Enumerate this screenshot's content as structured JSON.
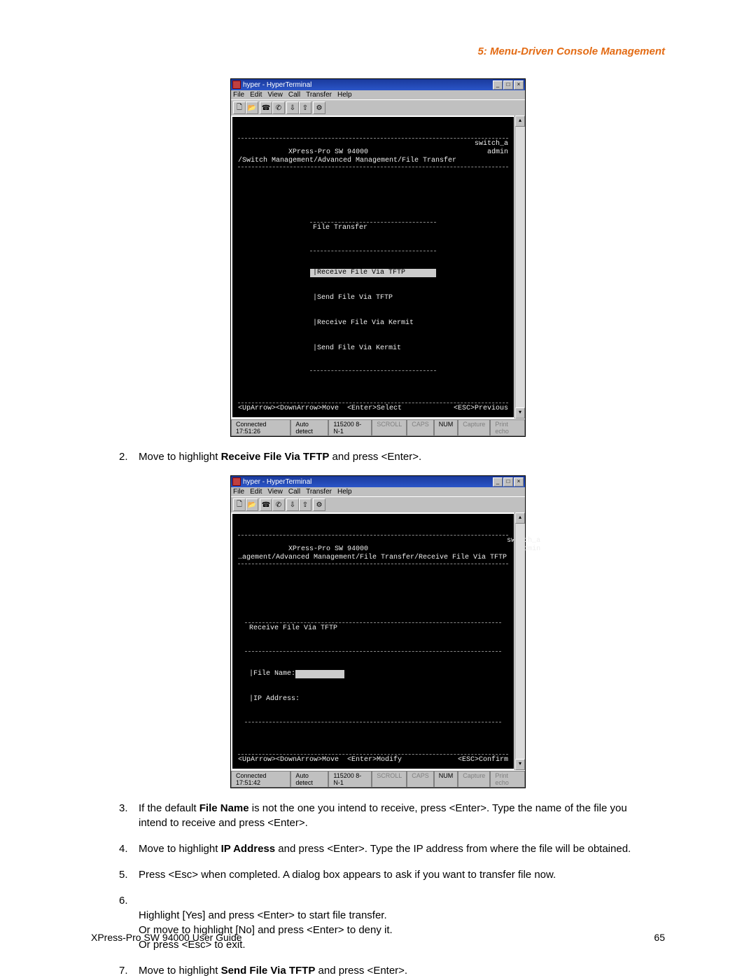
{
  "header": {
    "section_title": "5: Menu-Driven Console Management"
  },
  "screenshot_a": {
    "window_title": "hyper - HyperTerminal",
    "menus": [
      "File",
      "Edit",
      "View",
      "Call",
      "Transfer",
      "Help"
    ],
    "terminal": {
      "product": "XPress-Pro SW 94000",
      "breadcrumb": "/Switch Management/Advanced Management/File Transfer",
      "device": "switch_a",
      "user": "admin",
      "menu_title": "File Transfer",
      "items": [
        "Receive File Via TFTP",
        "Send File Via TFTP",
        "Receive File Via Kermit",
        "Send File Via Kermit"
      ],
      "footer_left": "<UpArrow><DownArrow>Move  <Enter>Select",
      "footer_right": "<ESC>Previous"
    },
    "statusbar": {
      "connected": "Connected 17:51:26",
      "detect": "Auto detect",
      "baud": "115200 8-N-1",
      "cells": [
        "SCROLL",
        "CAPS",
        "NUM",
        "Capture",
        "Print echo"
      ]
    }
  },
  "steps_a": {
    "num": "2.",
    "pre": "Move to highlight ",
    "bold": "Receive File Via TFTP",
    "post": " and press <Enter>."
  },
  "screenshot_b": {
    "window_title": "hyper - HyperTerminal",
    "menus": [
      "File",
      "Edit",
      "View",
      "Call",
      "Transfer",
      "Help"
    ],
    "terminal": {
      "product": "XPress-Pro SW 94000",
      "breadcrumb": "…agement/Advanced Management/File Transfer/Receive File Via TFTP",
      "device": "switch_a",
      "user": "admin",
      "form_title": "Receive File Via TFTP",
      "field1_label": "|File Name:",
      "field2_label": "|IP Address:",
      "footer_left": "<UpArrow><DownArrow>Move  <Enter>Modify",
      "footer_right": "<ESC>Confirm"
    },
    "statusbar": {
      "connected": "Connected 17:51:42",
      "detect": "Auto detect",
      "baud": "115200 8-N-1",
      "cells": [
        "SCROLL",
        "CAPS",
        "NUM",
        "Capture",
        "Print echo"
      ]
    }
  },
  "steps_b": [
    {
      "num": "3.",
      "pre": "If the default ",
      "bold": "File Name",
      "post": " is not the one you intend to receive, press <Enter>. Type the name of the file you intend to receive and press <Enter>."
    },
    {
      "num": "4.",
      "pre": "Move to highlight ",
      "bold": "IP Address",
      "post": " and press <Enter>. Type the IP address from where the file will be obtained."
    },
    {
      "num": "5.",
      "pre": "",
      "bold": "",
      "post": "Press <Esc> when completed. A dialog box appears to ask if you want to transfer file now."
    },
    {
      "num": "6.",
      "pre": "",
      "bold": "",
      "post": "Highlight [Yes] and press <Enter> to start file transfer.\nOr move to highlight [No] and press <Enter> to deny it.\nOr press <Esc> to exit."
    },
    {
      "num": "7.",
      "pre": "Move to highlight ",
      "bold": "Send File Via TFTP",
      "post": " and press <Enter>."
    }
  ],
  "footer": {
    "left": "XPress-Pro SW 94000 User Guide",
    "right": "65"
  }
}
